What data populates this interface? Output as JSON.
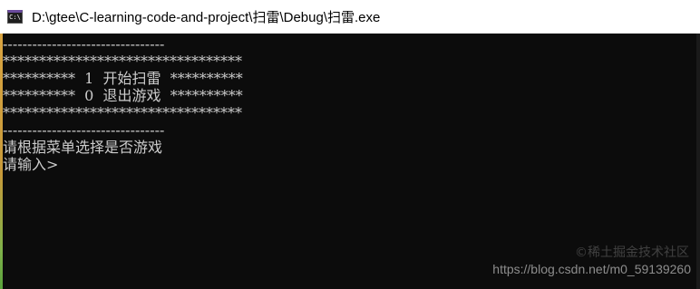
{
  "window": {
    "title": "D:\\gtee\\C-learning-code-and-project\\扫雷\\Debug\\扫雷.exe",
    "app_icon": "console-app-icon",
    "app_icon_text": "C:\\"
  },
  "console": {
    "lines": [
      "---------------------------------",
      "*********************************",
      "**********  1  开始扫雷  **********",
      "**********  0  退出游戏  **********",
      "*********************************",
      "---------------------------------",
      "请根据菜单选择是否游戏",
      "请输入>"
    ]
  },
  "watermark": {
    "platform_text": "©稀土掘金技术社区",
    "url": "https://blog.csdn.net/m0_59139260"
  },
  "colors": {
    "console_background": "#0c0c0c",
    "console_text": "#cccccc",
    "titlebar_background": "#ffffff"
  }
}
